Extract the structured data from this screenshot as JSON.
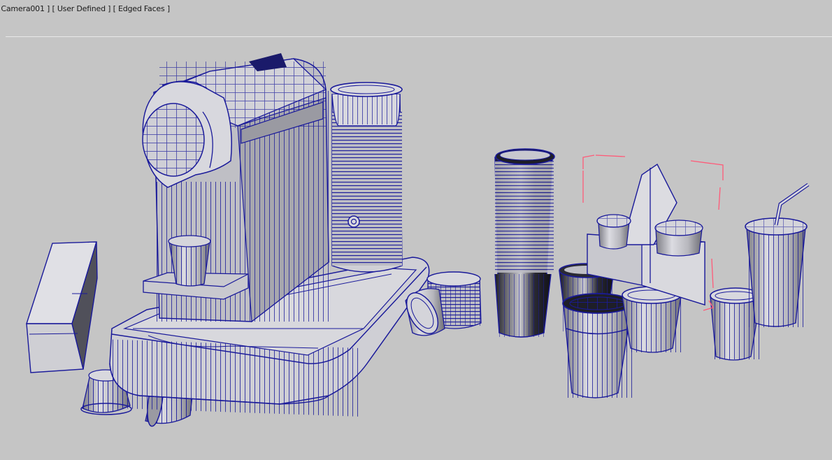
{
  "viewport": {
    "camera_label": "[ Camera001 ]",
    "shading_label": "[ User Defined ]",
    "edged_label": "[ Edged Faces ]"
  },
  "colors": {
    "background": "#c5c5c5",
    "wire": "#1a1a9a",
    "surface": "#a9a9ad",
    "surface_light": "#d7d7dc",
    "surface_dark": "#5a5a62",
    "selection_bracket": "#ff5a78"
  },
  "objects": [
    "coffee-machine",
    "milk-frother",
    "capsule-box",
    "capsule",
    "capsule-stack",
    "cup-stack",
    "paper-cup",
    "cup-carrier",
    "drink-cup-with-straw"
  ]
}
